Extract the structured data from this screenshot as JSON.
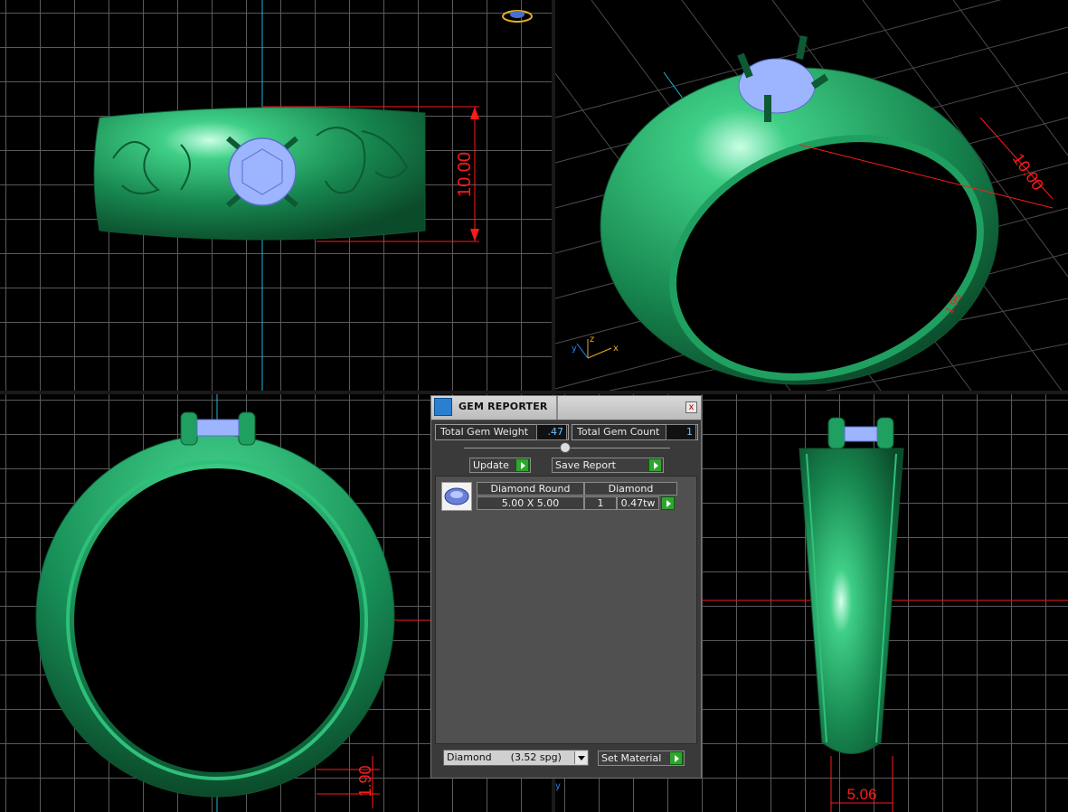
{
  "viewports": {
    "top_left": {
      "dimension": "10.00"
    },
    "top_right": {
      "dimension": "10.00",
      "small_dimension": "1.95",
      "axis_labels": [
        "z",
        "y",
        "x"
      ]
    },
    "bottom_left": {
      "dimension": "1.90"
    },
    "bottom_right": {
      "dimension": "5.06",
      "axis_label": "y"
    }
  },
  "gem_reporter": {
    "title": "GEM REPORTER",
    "close": "x",
    "total_gem_weight_label": "Total Gem Weight",
    "total_gem_weight_value": ".47",
    "total_gem_count_label": "Total Gem Count",
    "total_gem_count_value": "1",
    "update_label": "Update",
    "save_report_label": "Save Report",
    "gems": [
      {
        "shape": "Diamond Round",
        "size": "5.00 X 5.00",
        "material": "Diamond",
        "count": "1",
        "weight": "0.47tw"
      }
    ],
    "material_select": "Diamond      (3.52 spg)",
    "set_material_label": "Set Material"
  },
  "colors": {
    "ring_green": "#1fa060",
    "gem_blue": "#9db4ff",
    "dimension_red": "#ff1a1a",
    "axis_cyan": "#1ab6d8",
    "grid": "#5a5a5a"
  }
}
